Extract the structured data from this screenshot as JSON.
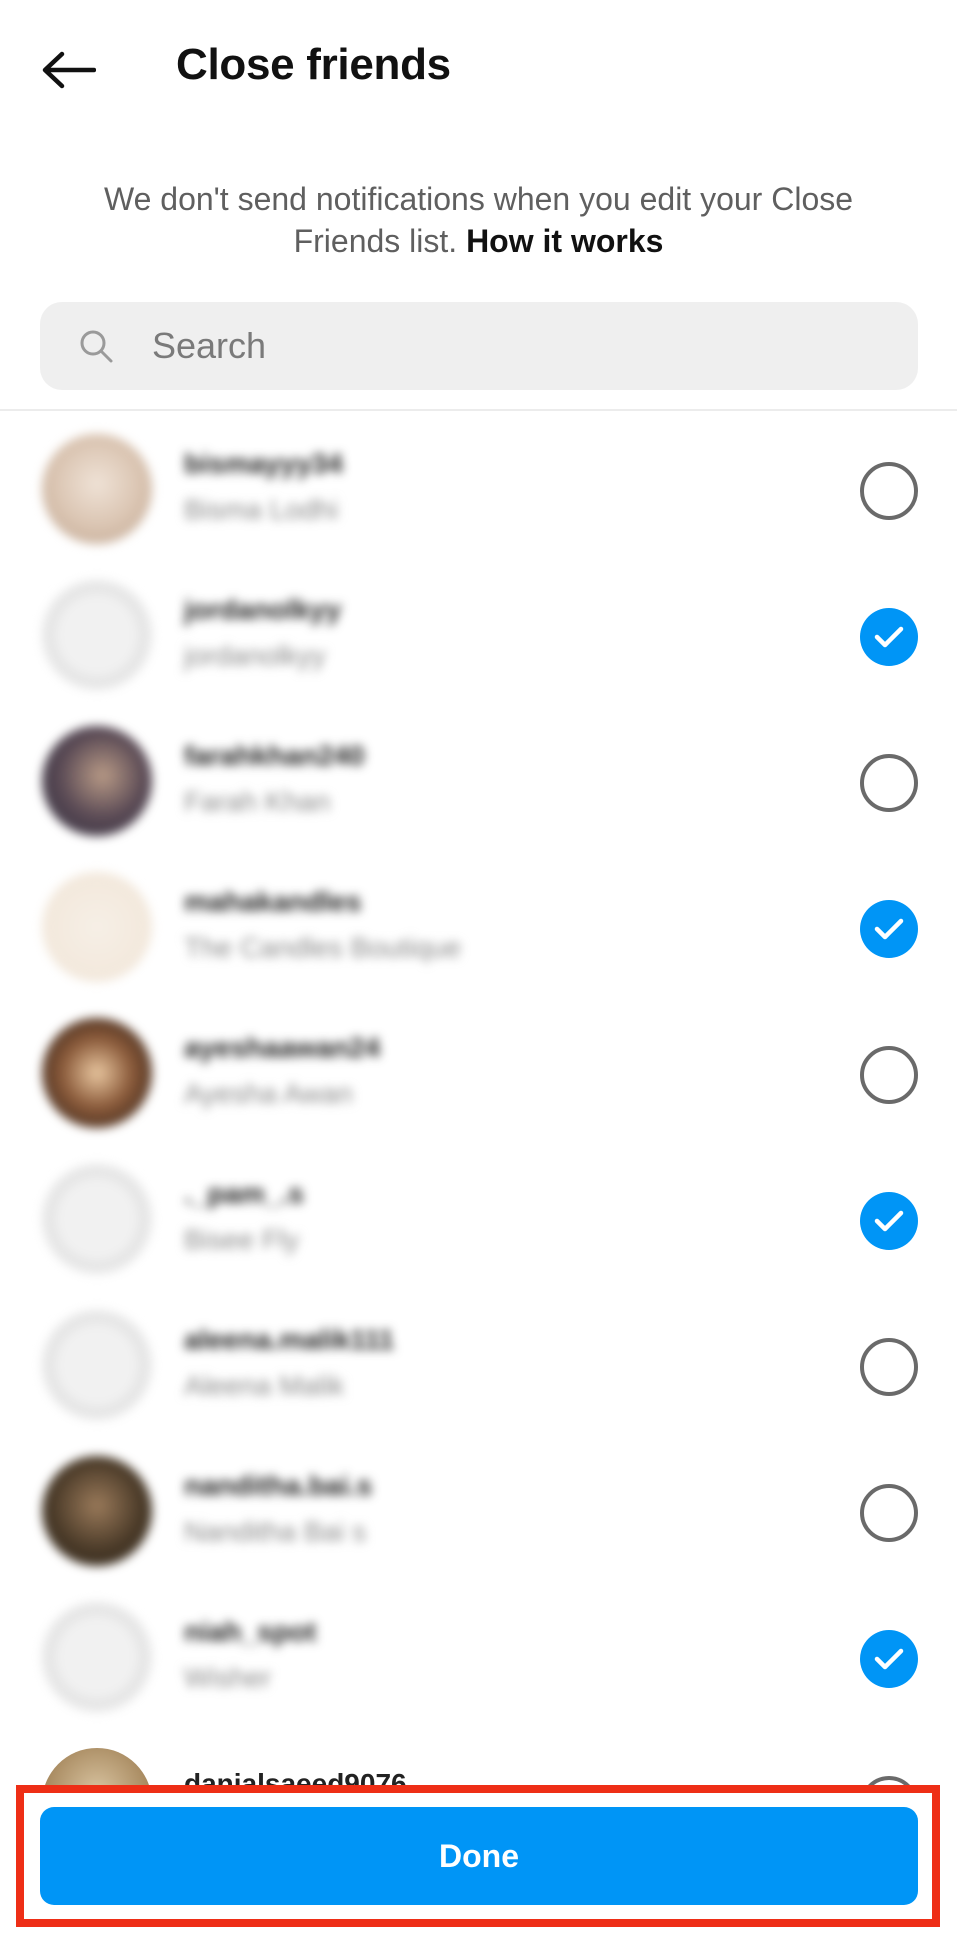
{
  "header": {
    "back_icon": "arrow-left-icon",
    "title": "Close friends"
  },
  "notice": {
    "text": "We don't send notifications when you edit your Close Friends list.",
    "link": "How it works"
  },
  "search": {
    "placeholder": "Search",
    "value": "",
    "icon": "search-icon"
  },
  "friends": [
    {
      "username": "bismayyy34",
      "full_name": "Bisma Lodhi",
      "selected": false
    },
    {
      "username": "jordanolkyy",
      "full_name": "jordanolkyy",
      "selected": true
    },
    {
      "username": "farahkhan240",
      "full_name": "Farah Khan",
      "selected": false
    },
    {
      "username": "mahakandles",
      "full_name": "The Candles Boutique",
      "selected": true
    },
    {
      "username": "ayeshaawan24",
      "full_name": "Ayesha Awan",
      "selected": false
    },
    {
      "username": "._pam_.s",
      "full_name": "Bisee Fly",
      "selected": true
    },
    {
      "username": "aleena.malik111",
      "full_name": "Aleena Malik",
      "selected": false
    },
    {
      "username": "nanditha.bai.s",
      "full_name": "Nanditha Bai s",
      "selected": false
    },
    {
      "username": "niah_spot",
      "full_name": "Wisher",
      "selected": true
    },
    {
      "username": "danialsaeed9076",
      "full_name": "",
      "selected": false
    }
  ],
  "footer": {
    "done_label": "Done"
  },
  "colors": {
    "accent": "#0095f6",
    "highlight": "#ee2e16"
  }
}
